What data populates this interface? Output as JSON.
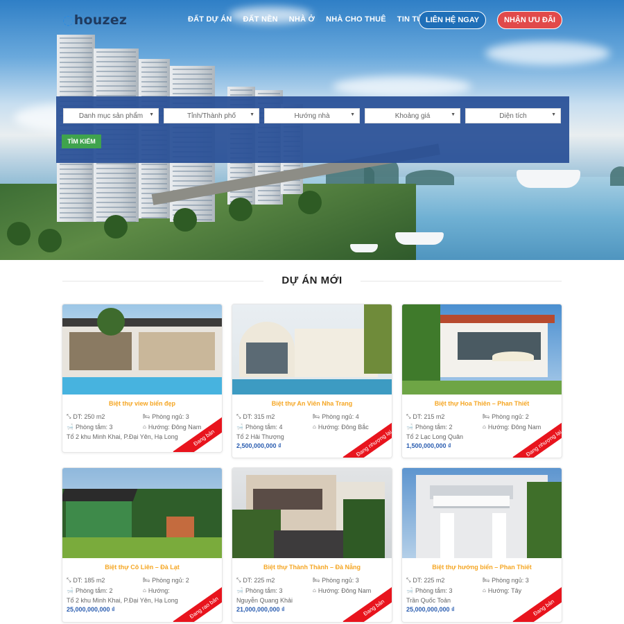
{
  "header": {
    "logo": "houzez",
    "nav": [
      "ĐẤT DỰ ÁN",
      "ĐẤT NỀN",
      "NHÀ Ở",
      "NHÀ CHO THUÊ",
      "TIN TỨC"
    ],
    "contact_button": "LIÊN HỆ NGAY",
    "offer_button": "NHẬN ƯU ĐÃI"
  },
  "search": {
    "selects": [
      "Danh mục sản phẩm",
      "Tỉnh/Thành phố",
      "Hướng nhà",
      "Khoảng giá",
      "Diện tích"
    ],
    "button": "TÌM KIẾM"
  },
  "section": {
    "title": "DỰ ÁN MỚI"
  },
  "cards": [
    {
      "title": "Biệt thự view biển đẹp",
      "area": "DT: 250 m2",
      "bedrooms": "Phòng ngủ: 3",
      "bathrooms": "Phòng tắm: 3",
      "direction": "Hướng: Đông Nam",
      "address": "Tổ 2 khu Minh Khai, P.Đại Yên, Hạ Long",
      "price": "",
      "ribbon": "Đang bán"
    },
    {
      "title": "Biệt thự An Viên Nha Trang",
      "area": "DT: 315 m2",
      "bedrooms": "Phòng ngủ: 4",
      "bathrooms": "Phòng tắm: 4",
      "direction": "Hướng: Đông Bắc",
      "address": "Tổ 2 Hải Thượng",
      "price": "2,500,000,000 ₫",
      "ribbon": "Đang nhượng lại"
    },
    {
      "title": "Biệt thự Hoa Thiên – Phan Thiết",
      "area": "DT: 215 m2",
      "bedrooms": "Phòng ngủ: 2",
      "bathrooms": "Phòng tắm: 2",
      "direction": "Hướng: Đông Nam",
      "address": "Tổ 2 Lạc Long Quân",
      "price": "1,500,000,000 ₫",
      "ribbon": "Đang nhượng lại"
    },
    {
      "title": "Biệt thự Cô Liên – Đà Lạt",
      "area": "DT: 185 m2",
      "bedrooms": "Phòng ngủ: 2",
      "bathrooms": "Phòng tắm: 2",
      "direction": "Hướng:",
      "address": "Tổ 2 khu Minh Khai, P.Đại Yên, Hạ Long",
      "price": "25,000,000,000 ₫",
      "ribbon": "Đang rao bán"
    },
    {
      "title": "Biệt thự Thành Thành – Đà Nẵng",
      "area": "DT: 225 m2",
      "bedrooms": "Phòng ngủ: 3",
      "bathrooms": "Phòng tắm: 3",
      "direction": "Hướng: Đông Nam",
      "address": "Nguyễn Quang Khải",
      "price": "21,000,000,000 ₫",
      "ribbon": "Đang bán"
    },
    {
      "title": "Biệt thự hướng biển – Phan Thiết",
      "area": "DT: 225 m2",
      "bedrooms": "Phòng ngủ: 3",
      "bathrooms": "Phòng tắm: 3",
      "direction": "Hướng: Tây",
      "address": "Trần Quốc Toản",
      "price": "25,000,000,000 ₫",
      "ribbon": "Đang bán"
    }
  ],
  "icons": {
    "area": "resize-icon",
    "bedroom": "bed-icon",
    "bathroom": "bathtub-icon",
    "direction": "home-icon"
  },
  "colors": {
    "accent_blue": "#1f6fb8",
    "accent_red": "#e14a4a",
    "search_panel": "#274e96",
    "search_button": "#3fa34d",
    "card_title": "#f5a623",
    "price": "#2a5db0",
    "ribbon": "#e8141d"
  }
}
